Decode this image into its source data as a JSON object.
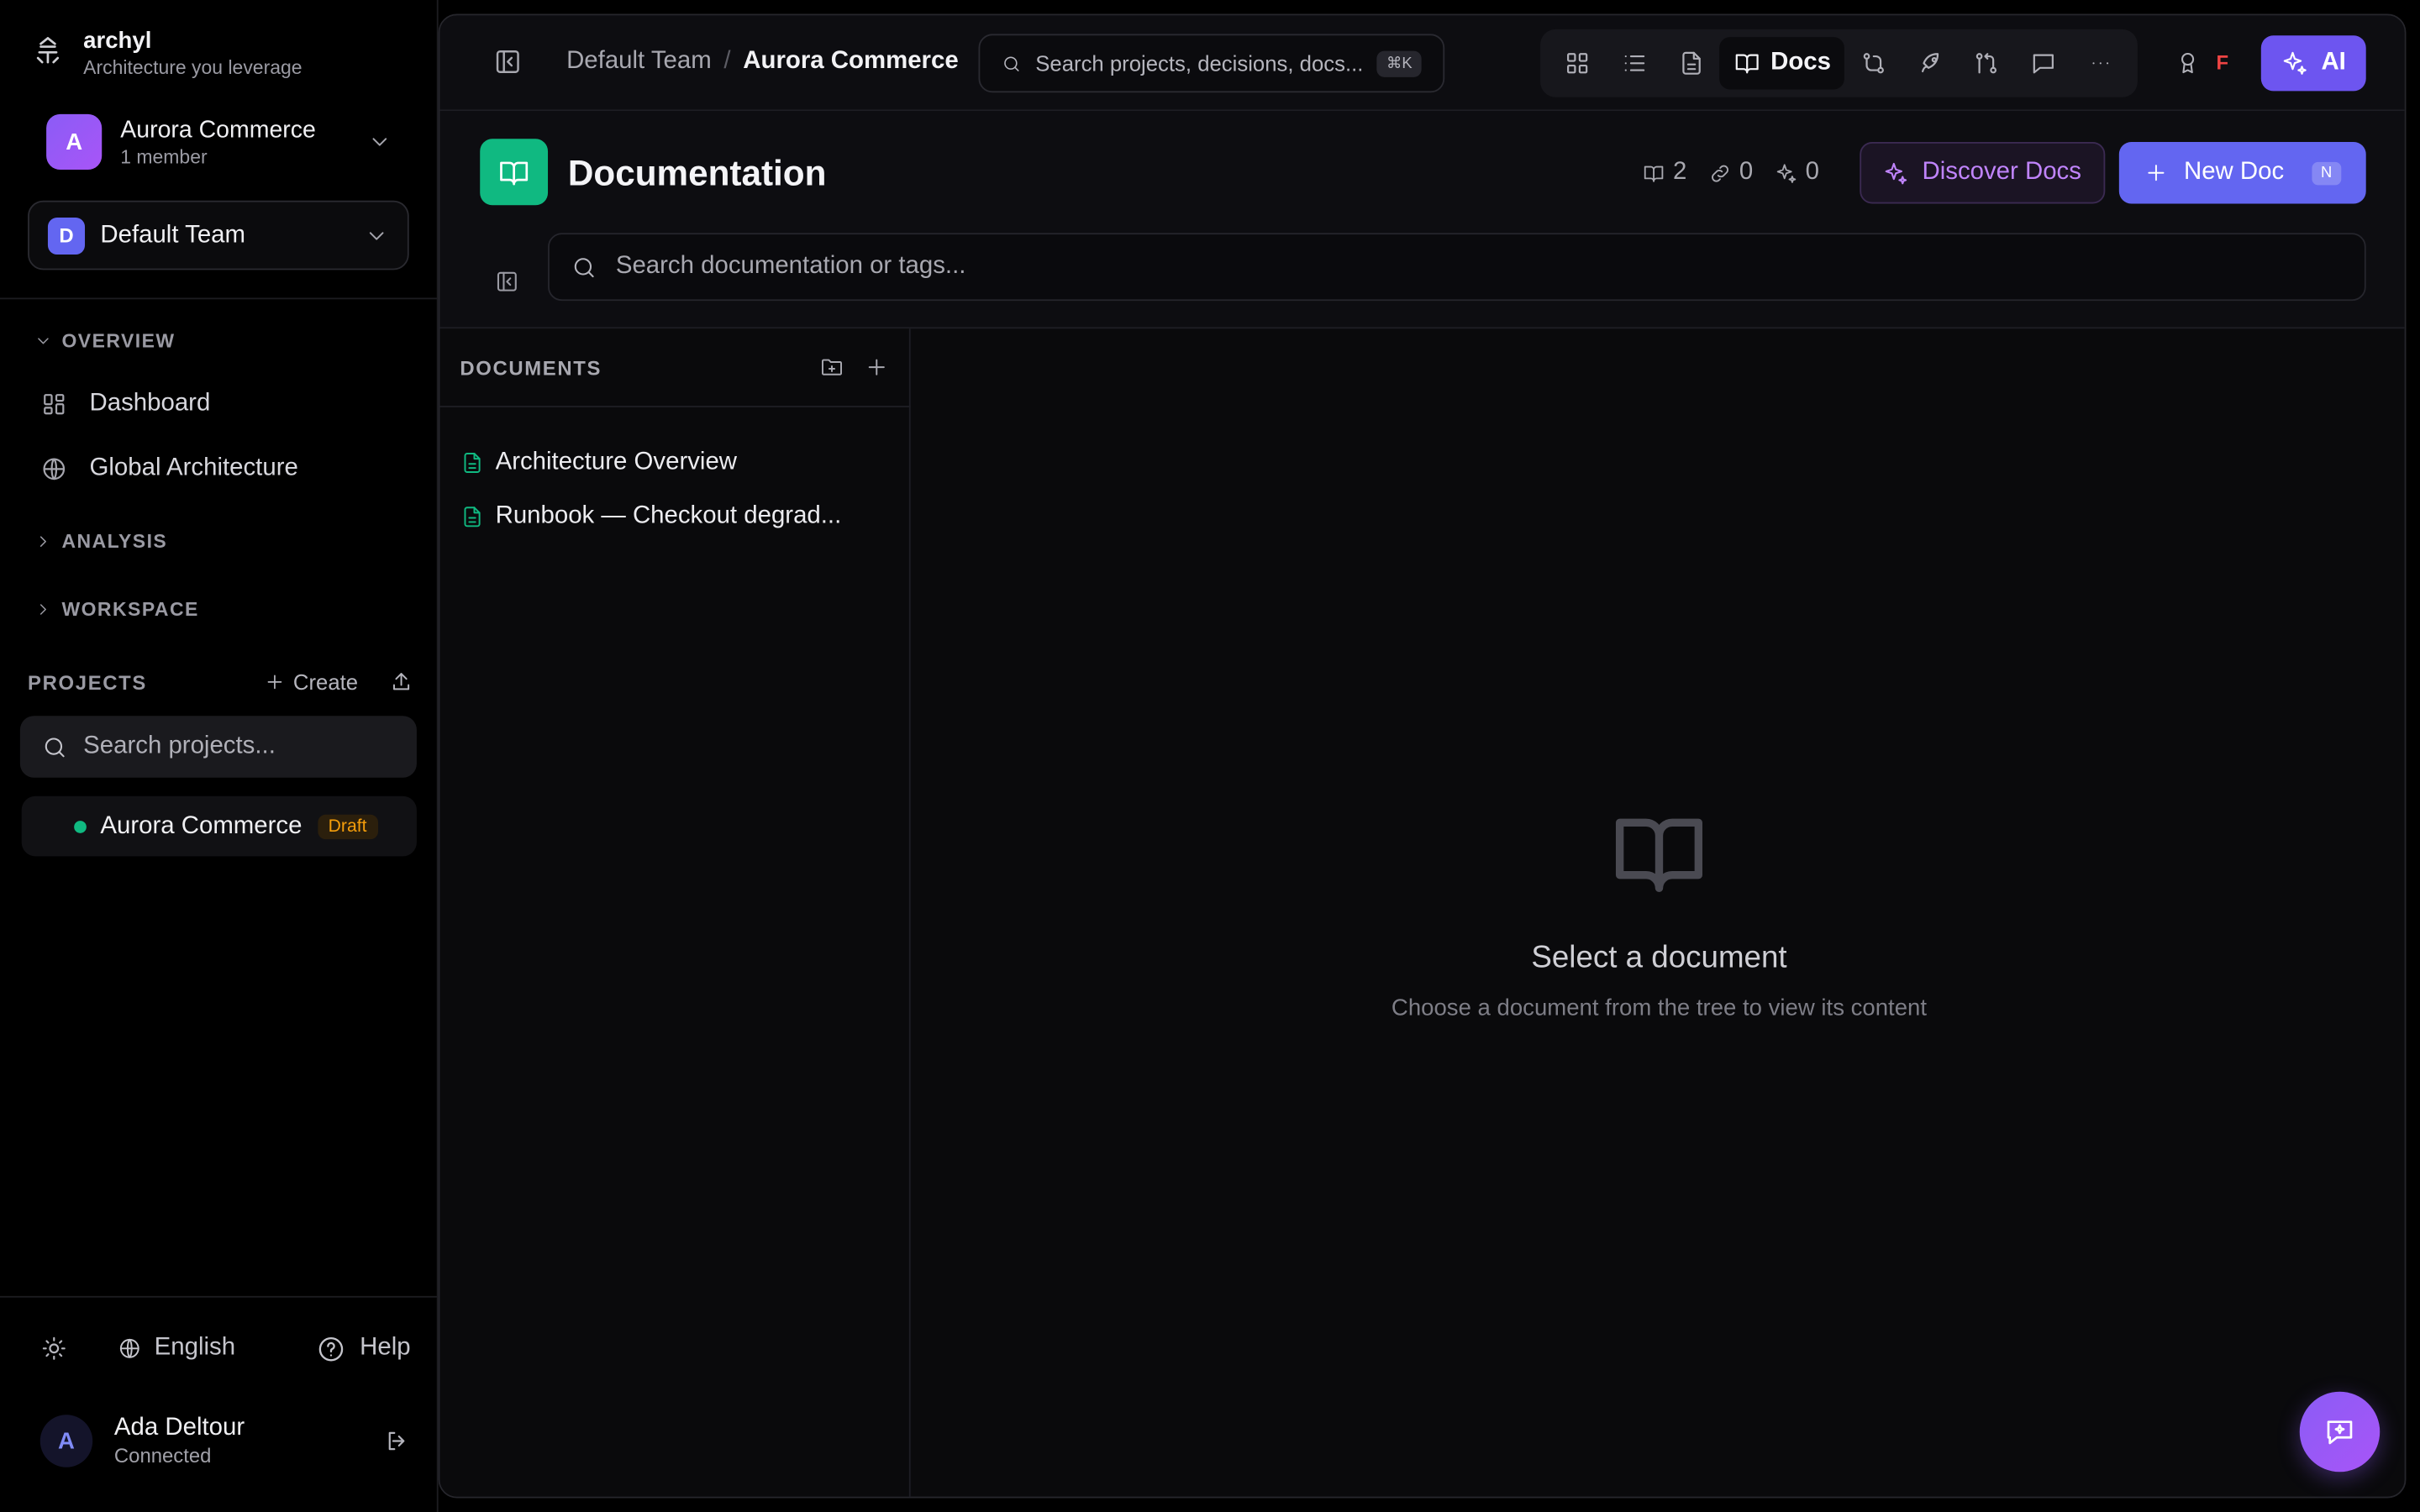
{
  "brand": {
    "name": "archyl",
    "tagline": "Architecture you leverage",
    "logo_icon": "archyl-logo-icon"
  },
  "org": {
    "name": "Aurora Commerce",
    "initial": "A",
    "members": "1 member"
  },
  "team": {
    "name": "Default Team",
    "initial": "D"
  },
  "sidebar": {
    "overview_label": "OVERVIEW",
    "items": [
      {
        "label": "Dashboard",
        "icon": "dashboard-icon"
      },
      {
        "label": "Global Architecture",
        "icon": "globe-icon"
      }
    ],
    "analysis_label": "ANALYSIS",
    "workspace_label": "WORKSPACE"
  },
  "projects": {
    "title": "PROJECTS",
    "create_label": "Create",
    "search_placeholder": "Search projects...",
    "items": [
      {
        "name": "Aurora Commerce",
        "badge": "Draft",
        "status_color": "#10b981"
      }
    ]
  },
  "footer": {
    "language": "English",
    "help": "Help"
  },
  "user": {
    "name": "Ada Deltour",
    "initial": "A",
    "status": "Connected"
  },
  "topbar": {
    "breadcrumb": [
      "Default Team",
      "Aurora Commerce"
    ],
    "separator": "/",
    "search_placeholder": "Search projects, decisions, docs...",
    "search_shortcut": "⌘K",
    "active_mode": "Docs",
    "rank_letter": "F",
    "ai_label": "AI"
  },
  "page": {
    "title": "Documentation",
    "stats": {
      "docs": "2",
      "links": "0",
      "ai": "0"
    },
    "discover_label": "Discover Docs",
    "new_doc_label": "New Doc",
    "new_doc_shortcut": "N",
    "search_placeholder": "Search documentation or tags..."
  },
  "tree": {
    "title": "DOCUMENTS",
    "items": [
      "Architecture Overview",
      "Runbook — Checkout degrad..."
    ]
  },
  "empty": {
    "title": "Select a document",
    "subtitle": "Choose a document from the tree to view its content"
  },
  "colors": {
    "accent": "#6366f1",
    "docs_green": "#10b981",
    "ai_purple": "#6d55f0",
    "discover_text": "#c084fc",
    "draft_badge": "#f59e0b"
  }
}
